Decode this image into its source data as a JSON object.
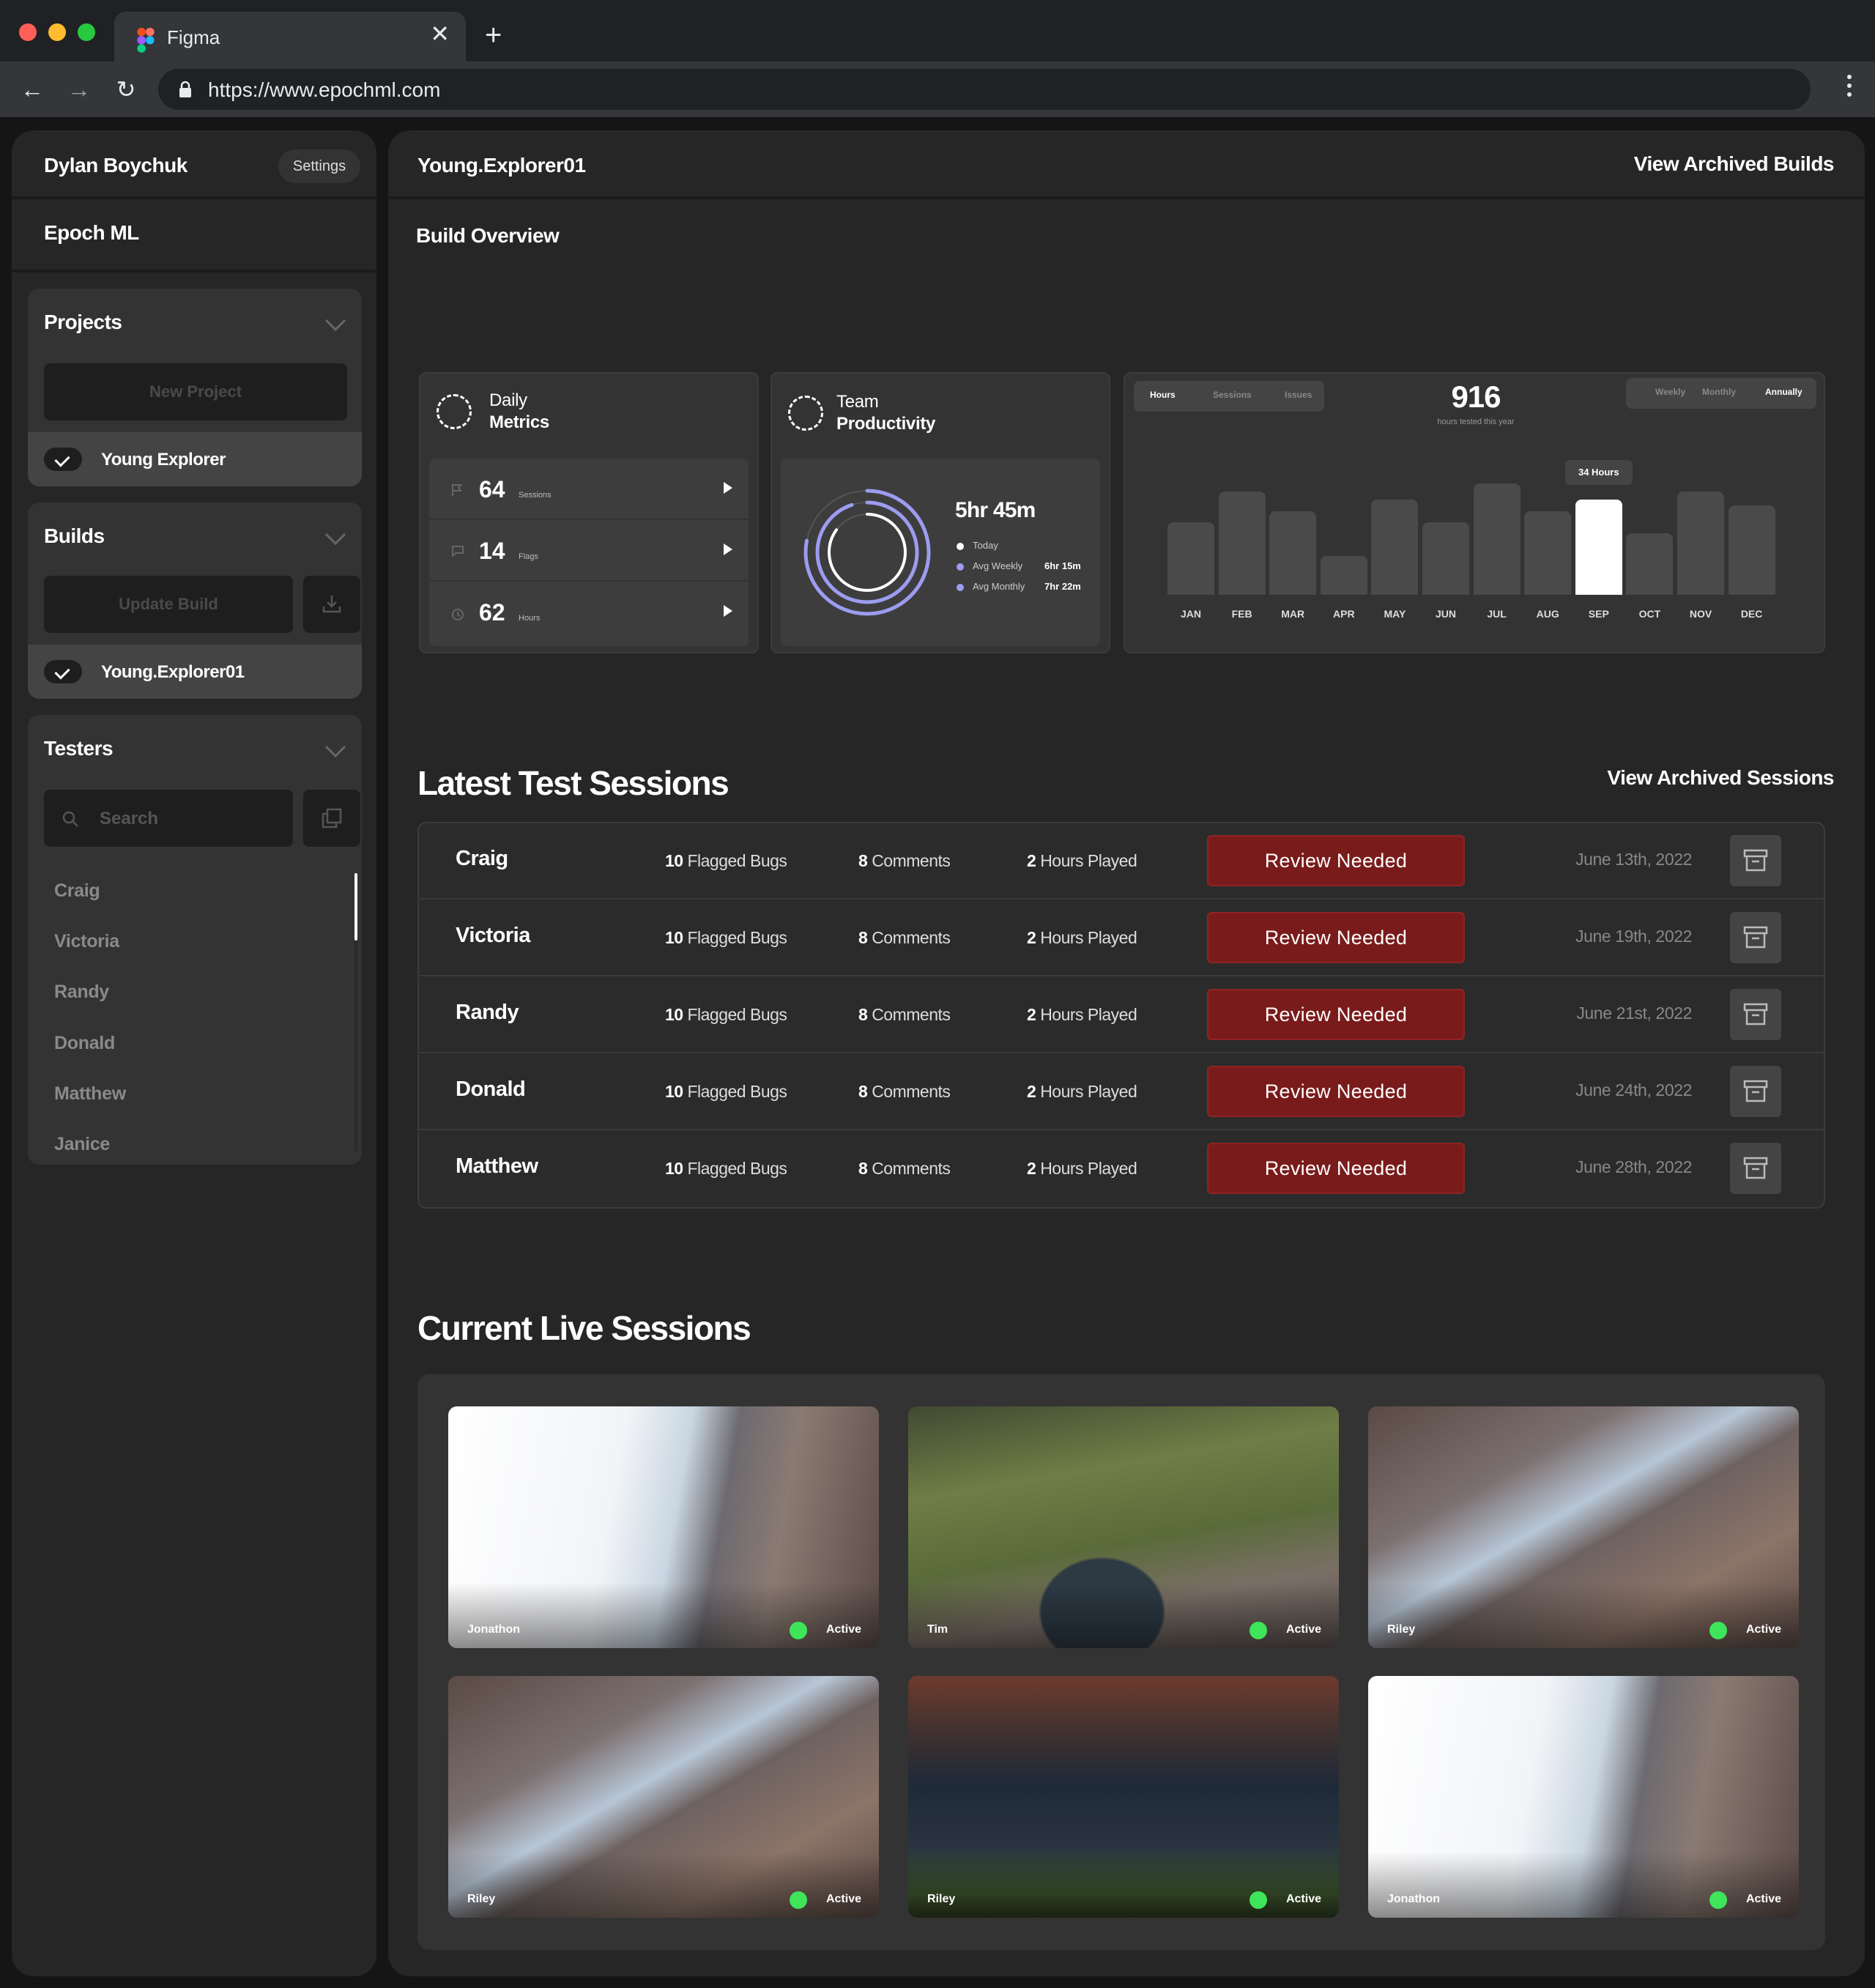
{
  "browser": {
    "tab_title": "Figma",
    "url": "https://www.epochml.com"
  },
  "sidebar": {
    "user_name": "Dylan Boychuk",
    "settings_label": "Settings",
    "org_name": "Epoch ML",
    "projects": {
      "title": "Projects",
      "new_button": "New Project",
      "selected": "Young Explorer"
    },
    "builds": {
      "title": "Builds",
      "update_button": "Update Build",
      "selected": "Young.Explorer01"
    },
    "testers": {
      "title": "Testers",
      "search_placeholder": "Search",
      "items": [
        "Craig",
        "Victoria",
        "Randy",
        "Donald",
        "Matthew",
        "Janice"
      ]
    }
  },
  "main": {
    "build_name": "Young.Explorer01",
    "view_archived_builds": "View Archived Builds",
    "overview_title": "Build Overview",
    "daily_metrics": {
      "title_line1": "Daily",
      "title_line2": "Metrics",
      "rows": [
        {
          "value": "64",
          "unit": "Sessions"
        },
        {
          "value": "14",
          "unit": "Flags"
        },
        {
          "value": "62",
          "unit": "Hours"
        }
      ]
    },
    "team_productivity": {
      "title_line1": "Team",
      "title_line2": "Productivity",
      "total": "5hr 45m",
      "legend": [
        {
          "label": "Today",
          "value": "",
          "color": "#ffffff"
        },
        {
          "label": "Avg Weekly",
          "value": "6hr 15m",
          "color": "#9c9cf0"
        },
        {
          "label": "Avg Monthly",
          "value": "7hr 22m",
          "color": "#9c9cf0"
        }
      ],
      "rings": [
        0.78,
        0.95,
        0.85
      ]
    },
    "hours_chart": {
      "tabs": [
        "Hours",
        "Sessions",
        "Issues"
      ],
      "active_tab": "Hours",
      "periods": [
        "Weekly",
        "Monthly",
        "Annually"
      ],
      "active_period": "Annually",
      "total": "916",
      "total_caption": "hours tested this year",
      "tooltip": "34 Hours",
      "highlight_color": "#ffffff",
      "bar_color": "#4a4a4a"
    },
    "latest_sessions": {
      "title": "Latest Test Sessions",
      "view_archived": "View Archived Sessions",
      "rows": [
        {
          "name": "Craig",
          "bugs_num": "10",
          "bugs_label": "Flagged Bugs",
          "comments_num": "8",
          "comments_label": "Comments",
          "hours_num": "2",
          "hours_label": "Hours Played",
          "status": "Review Needed",
          "date": "June 13th, 2022"
        },
        {
          "name": "Victoria",
          "bugs_num": "10",
          "bugs_label": "Flagged Bugs",
          "comments_num": "8",
          "comments_label": "Comments",
          "hours_num": "2",
          "hours_label": "Hours Played",
          "status": "Review Needed",
          "date": "June 19th, 2022"
        },
        {
          "name": "Randy",
          "bugs_num": "10",
          "bugs_label": "Flagged Bugs",
          "comments_num": "8",
          "comments_label": "Comments",
          "hours_num": "2",
          "hours_label": "Hours Played",
          "status": "Review Needed",
          "date": "June 21st, 2022"
        },
        {
          "name": "Donald",
          "bugs_num": "10",
          "bugs_label": "Flagged Bugs",
          "comments_num": "8",
          "comments_label": "Comments",
          "hours_num": "2",
          "hours_label": "Hours Played",
          "status": "Review Needed",
          "date": "June 24th, 2022"
        },
        {
          "name": "Matthew",
          "bugs_num": "10",
          "bugs_label": "Flagged Bugs",
          "comments_num": "8",
          "comments_label": "Comments",
          "hours_num": "2",
          "hours_label": "Hours Played",
          "status": "Review Needed",
          "date": "June 28th, 2022"
        }
      ]
    },
    "live_sessions": {
      "title": "Current Live Sessions",
      "status_label": "Active",
      "cards": [
        {
          "name": "Jonathon",
          "scene": "bright"
        },
        {
          "name": "Tim",
          "scene": "grass"
        },
        {
          "name": "Riley",
          "scene": "rock"
        },
        {
          "name": "Riley",
          "scene": "rock"
        },
        {
          "name": "Riley",
          "scene": "village"
        },
        {
          "name": "Jonathon",
          "scene": "bright"
        }
      ]
    }
  },
  "chart_data": {
    "type": "bar",
    "title": "",
    "categories": [
      "JAN",
      "FEB",
      "MAR",
      "APR",
      "MAY",
      "JUN",
      "JUL",
      "AUG",
      "SEP",
      "OCT",
      "NOV",
      "DEC"
    ],
    "values": [
      26,
      37,
      30,
      14,
      34,
      26,
      40,
      30,
      34,
      22,
      37,
      32
    ],
    "highlight_index": 8,
    "ylim": [
      0,
      42
    ],
    "xlabel": "",
    "ylabel": "",
    "grid": false
  }
}
